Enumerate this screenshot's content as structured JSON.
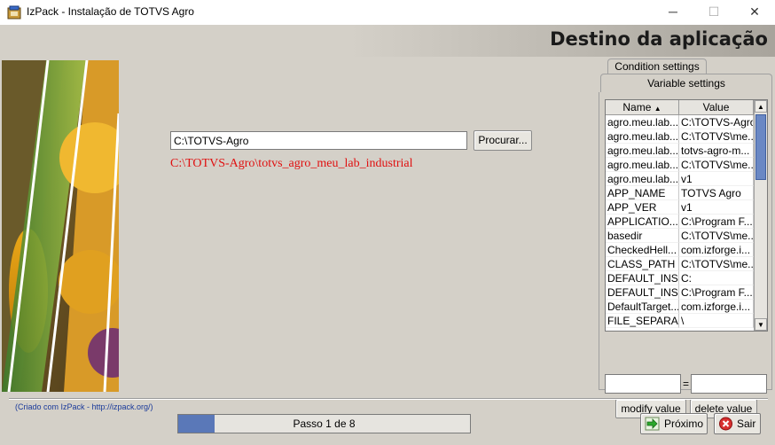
{
  "window": {
    "title": "IzPack - Instalação de TOTVS Agro",
    "minimize_glyph": "─",
    "maximize_glyph": "☐",
    "close_glyph": "✕"
  },
  "header": {
    "title": "Destino da aplicação"
  },
  "destination": {
    "path_value": "C:\\TOTVS-Agro",
    "browse_label": "Procurar...",
    "full_path_info": "C:\\TOTVS-Agro\\totvs_agro_meu_lab_industrial"
  },
  "debug_panel": {
    "tabs": [
      {
        "label": "Condition settings"
      },
      {
        "label": "Variable settings"
      }
    ],
    "table": {
      "headers": [
        "Name",
        "Value"
      ],
      "sort_indicator": "▲",
      "rows": [
        {
          "name": "agro.meu.lab...",
          "value": "C:\\TOTVS-Agro"
        },
        {
          "name": "agro.meu.lab...",
          "value": "C:\\TOTVS\\me..."
        },
        {
          "name": "agro.meu.lab...",
          "value": "totvs-agro-m..."
        },
        {
          "name": "agro.meu.lab...",
          "value": "C:\\TOTVS\\me..."
        },
        {
          "name": "agro.meu.lab...",
          "value": "v1"
        },
        {
          "name": "APP_NAME",
          "value": "TOTVS Agro"
        },
        {
          "name": "APP_VER",
          "value": "v1"
        },
        {
          "name": "APPLICATIO...",
          "value": "C:\\Program F..."
        },
        {
          "name": "basedir",
          "value": "C:\\TOTVS\\me..."
        },
        {
          "name": "CheckedHell...",
          "value": "com.izforge.i..."
        },
        {
          "name": "CLASS_PATH",
          "value": "C:\\TOTVS\\me..."
        },
        {
          "name": "DEFAULT_INS...",
          "value": "C:"
        },
        {
          "name": "DEFAULT_INS...",
          "value": "C:\\Program F..."
        },
        {
          "name": "DefaultTarget...",
          "value": "com.izforge.i..."
        },
        {
          "name": "FILE_SEPARA...",
          "value": "\\"
        }
      ]
    },
    "edit_name_value": "",
    "equals_sign": "=",
    "edit_value_value": "",
    "modify_label": "modify value",
    "delete_label": "delete value"
  },
  "footer": {
    "credit": "(Criado com IzPack - http://izpack.org/)",
    "progress_text": "Passo 1 de 8",
    "progress_fraction": 0.125,
    "next_label": "Próximo",
    "exit_label": "Sair"
  },
  "colors": {
    "accent": "#5a78b8",
    "info_text": "#e01010",
    "credit_text": "#1a3a9a"
  }
}
